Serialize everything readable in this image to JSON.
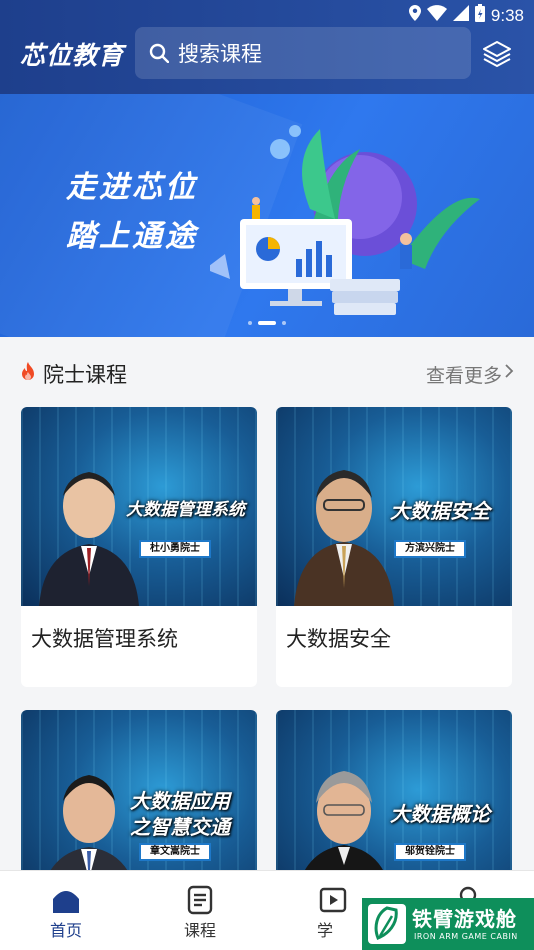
{
  "status_bar": {
    "time": "9:38"
  },
  "header": {
    "logo": "芯位教育",
    "search_placeholder": "搜索课程"
  },
  "banner": {
    "line1": "走进芯位",
    "line2": "踏上通途",
    "pager": {
      "count": 3,
      "active": 2
    }
  },
  "section": {
    "title": "院士课程",
    "more": "查看更多"
  },
  "courses": [
    {
      "thumb_title": "大数据管理系统",
      "badge": "杜小勇院士",
      "title": "大数据管理系统"
    },
    {
      "thumb_title": "大数据安全",
      "badge": "方滨兴院士",
      "title": "大数据安全"
    },
    {
      "thumb_title_line1": "大数据应用",
      "thumb_title_line2": "之智慧交通",
      "badge": "章文嵩院士"
    },
    {
      "thumb_title": "大数据概论",
      "badge": "邬贺铨院士"
    }
  ],
  "bottom_nav": [
    {
      "label": "首页",
      "icon": "home-icon",
      "active": true
    },
    {
      "label": "课程",
      "icon": "document-icon",
      "active": false
    },
    {
      "label": "学",
      "icon": "play-icon",
      "active": false
    },
    {
      "label": "",
      "icon": "profile-icon",
      "active": false
    }
  ],
  "watermark": {
    "title": "铁臂游戏舱",
    "subtitle": "IRON ARM GAME CABIN"
  },
  "colors": {
    "header": "#1e3f8c",
    "banner": "#2f78ee",
    "active_tab": "#1e3f8c",
    "watermark": "#0e8f5b"
  }
}
